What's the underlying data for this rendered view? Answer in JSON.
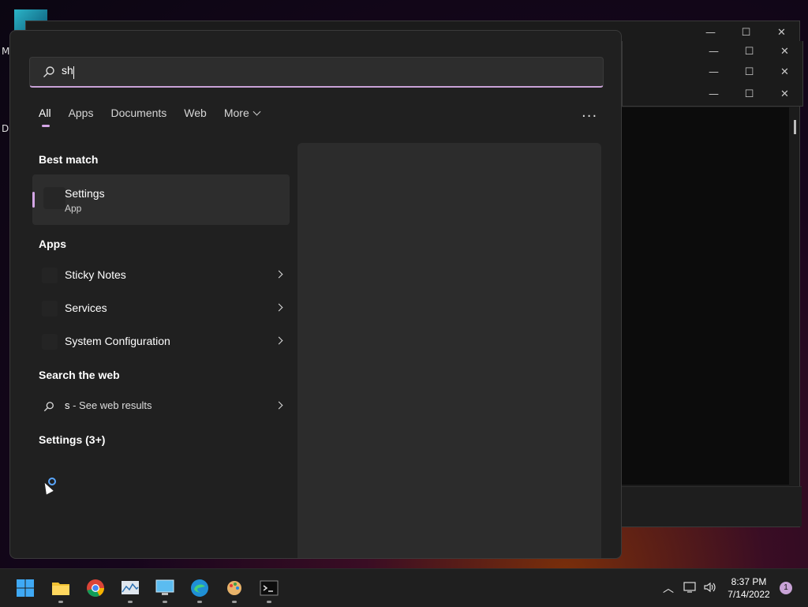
{
  "desktop": {
    "side_letter_1": "M",
    "side_letter_2": "Di"
  },
  "search": {
    "value": "sh"
  },
  "tabs": [
    {
      "label": "All",
      "active": true
    },
    {
      "label": "Apps"
    },
    {
      "label": "Documents"
    },
    {
      "label": "Web"
    },
    {
      "label": "More"
    }
  ],
  "more_options": "···",
  "sections": {
    "best_match": "Best match",
    "apps": "Apps",
    "search_web": "Search the web",
    "settings_more": "Settings (3+)"
  },
  "best_match": {
    "name": "Settings",
    "type": "App"
  },
  "apps": [
    {
      "label": "Sticky Notes"
    },
    {
      "label": "Services"
    },
    {
      "label": "System Configuration"
    }
  ],
  "web_result": {
    "query": "s",
    "suffix": " - See web results"
  },
  "taskbar": {
    "apps": [
      "start-icon",
      "file-explorer-icon",
      "chrome-icon",
      "resource-monitor-icon",
      "remote-desktop-icon",
      "edge-icon",
      "paint-icon",
      "terminal-icon"
    ],
    "time": "8:37 PM",
    "date": "7/14/2022",
    "notification_count": "1"
  },
  "colors": {
    "accent": "#d4a6e6",
    "menu_bg": "#202020",
    "preview_bg": "#2c2c2c"
  }
}
